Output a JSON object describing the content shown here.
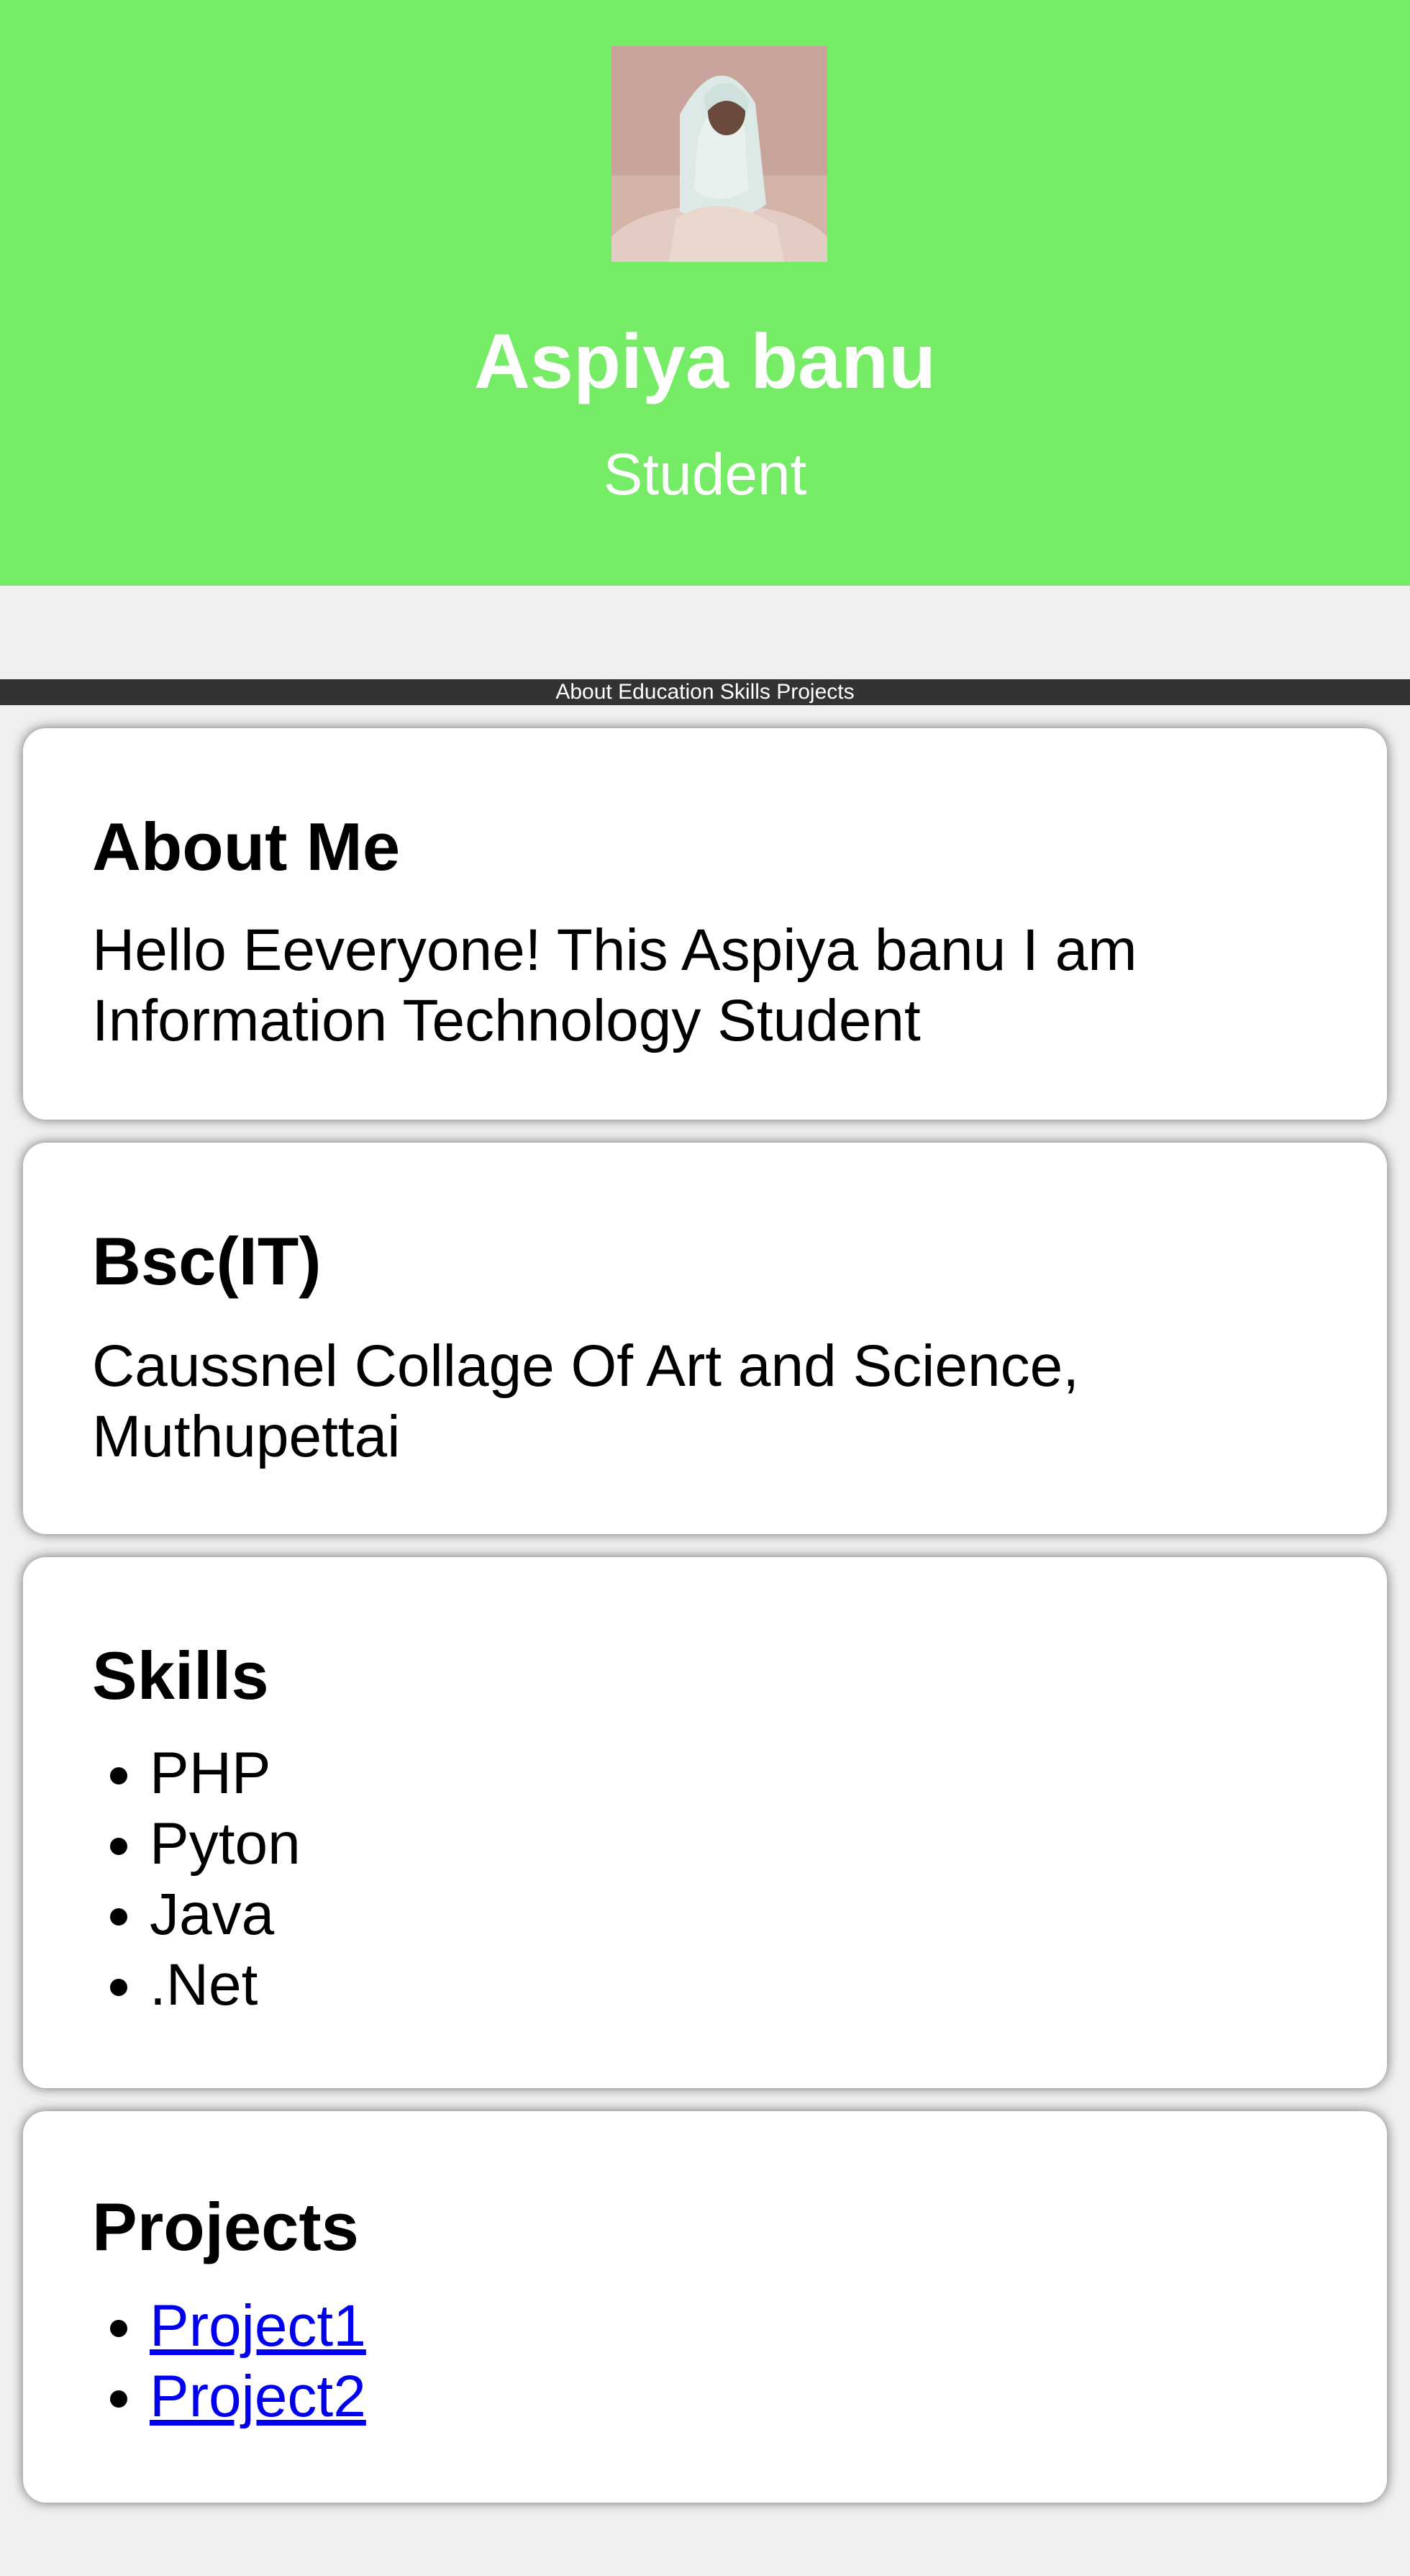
{
  "header": {
    "name": "Aspiya banu",
    "role": "Student",
    "background_color": "#76eb66"
  },
  "nav": {
    "items": [
      "About",
      "Education",
      "Skills",
      "Projects"
    ]
  },
  "about": {
    "heading": "About Me",
    "text": "Hello Eeveryone! This Aspiya banu I am Information Technology Student"
  },
  "education": {
    "heading": "Bsc(IT)",
    "text": "Caussnel Collage Of Art and Science, Muthupettai"
  },
  "skills": {
    "heading": "Skills",
    "items": [
      "PHP",
      "Pyton",
      "Java",
      ".Net"
    ]
  },
  "projects": {
    "heading": "Projects",
    "items": [
      "Project1",
      "Project2"
    ],
    "link_color": "#0000ee"
  }
}
